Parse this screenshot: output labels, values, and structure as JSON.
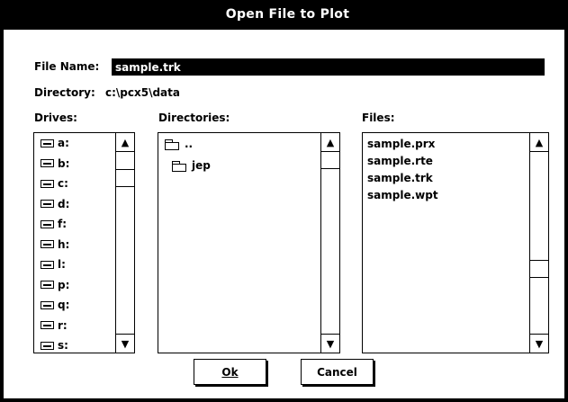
{
  "window": {
    "title": "Open File to Plot"
  },
  "file_name": {
    "label": "File Name:",
    "value": "sample.trk"
  },
  "directory": {
    "label": "Directory:",
    "path": "c:\\pcx5\\data"
  },
  "drives": {
    "label": "Drives:",
    "items": [
      {
        "label": "a:",
        "icon": "floppy-drive-icon"
      },
      {
        "label": "b:",
        "icon": "floppy-drive-icon"
      },
      {
        "label": "c:",
        "icon": "hard-drive-icon"
      },
      {
        "label": "d:",
        "icon": "hard-drive-icon"
      },
      {
        "label": "f:",
        "icon": "network-drive-icon"
      },
      {
        "label": "h:",
        "icon": "network-drive-icon"
      },
      {
        "label": "l:",
        "icon": "network-drive-icon"
      },
      {
        "label": "p:",
        "icon": "network-drive-icon"
      },
      {
        "label": "q:",
        "icon": "network-drive-icon"
      },
      {
        "label": "r:",
        "icon": "network-drive-icon"
      },
      {
        "label": "s:",
        "icon": "network-drive-icon"
      }
    ]
  },
  "directories": {
    "label": "Directories:",
    "items": [
      {
        "label": "..",
        "icon": "open-folder-icon"
      },
      {
        "label": "jep",
        "icon": "folder-icon"
      }
    ]
  },
  "files": {
    "label": "Files:",
    "items": [
      "sample.prx",
      "sample.rte",
      "sample.trk",
      "sample.wpt"
    ]
  },
  "buttons": {
    "ok": "Ok",
    "cancel": "Cancel"
  },
  "scroll_arrows": {
    "up": "▲",
    "down": "▼"
  }
}
